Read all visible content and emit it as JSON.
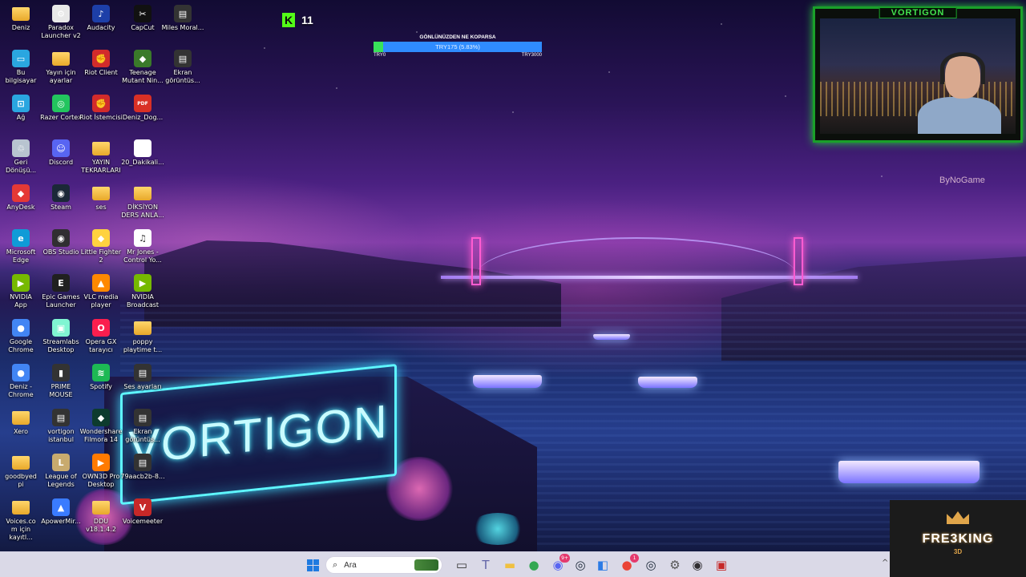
{
  "desktop_icons": [
    {
      "id": "deniz-folder",
      "label": "Deniz",
      "glyph": "folder",
      "color": "#f0c040",
      "col": 0,
      "row": 0
    },
    {
      "id": "paradox-launcher",
      "label": "Paradox Launcher v2",
      "glyph": "gear",
      "color": "#e8e8e8",
      "col": 1,
      "row": 0
    },
    {
      "id": "audacity",
      "label": "Audacity",
      "glyph": "audacity",
      "color": "#1d3fa8",
      "col": 2,
      "row": 0
    },
    {
      "id": "capcut",
      "label": "CapCut",
      "glyph": "capcut",
      "color": "#111111",
      "col": 3,
      "row": 0
    },
    {
      "id": "miles-moral",
      "label": "Miles Moral...",
      "glyph": "screenshot",
      "color": "#333333",
      "col": 4,
      "row": 0
    },
    {
      "id": "bu-bilgisayar",
      "label": "Bu bilgisayar",
      "glyph": "monitor",
      "color": "#2aa6e0",
      "col": 0,
      "row": 1
    },
    {
      "id": "yayin-icin-ayarlar",
      "label": "Yayın için ayarlar",
      "glyph": "folder",
      "color": "#f0c040",
      "col": 1,
      "row": 1
    },
    {
      "id": "riot-client",
      "label": "Riot Client",
      "glyph": "riot",
      "color": "#d22b2b",
      "col": 2,
      "row": 1
    },
    {
      "id": "teenage-mutant",
      "label": "Teenage Mutant Nin...",
      "glyph": "game",
      "color": "#3a7a2a",
      "col": 3,
      "row": 1
    },
    {
      "id": "ekran-goruntusu-1",
      "label": "Ekran görüntüs...",
      "glyph": "screenshot",
      "color": "#333333",
      "col": 4,
      "row": 1
    },
    {
      "id": "ag",
      "label": "Ağ",
      "glyph": "network",
      "color": "#2aa6e0",
      "col": 0,
      "row": 2
    },
    {
      "id": "razer-cortex",
      "label": "Razer Cortex",
      "glyph": "razer",
      "color": "#22c55e",
      "col": 1,
      "row": 2
    },
    {
      "id": "riot-istemcisi",
      "label": "Riot İstemcisi",
      "glyph": "riot",
      "color": "#d22b2b",
      "col": 2,
      "row": 2
    },
    {
      "id": "deniz-dog",
      "label": "Deniz_Dog...",
      "glyph": "pdf",
      "color": "#d93025",
      "col": 3,
      "row": 2
    },
    {
      "id": "geri-donusum",
      "label": "Geri Dönüşü...",
      "glyph": "bin",
      "color": "#b8c4d0",
      "col": 0,
      "row": 3
    },
    {
      "id": "discord",
      "label": "Discord",
      "glyph": "discord",
      "color": "#5865f2",
      "col": 1,
      "row": 3
    },
    {
      "id": "yayin-tekrarlari",
      "label": "YAYIN TEKRARLARI",
      "glyph": "folder",
      "color": "#f0c040",
      "col": 2,
      "row": 3
    },
    {
      "id": "20-dakikali",
      "label": "20_Dakikali...",
      "glyph": "file",
      "color": "#ffffff",
      "col": 3,
      "row": 3
    },
    {
      "id": "anydesk",
      "label": "AnyDesk",
      "glyph": "anydesk",
      "color": "#e53935",
      "col": 0,
      "row": 4
    },
    {
      "id": "steam",
      "label": "Steam",
      "glyph": "steam",
      "color": "#1b2838",
      "col": 1,
      "row": 4
    },
    {
      "id": "ses-folder",
      "label": "ses",
      "glyph": "folder",
      "color": "#f0c040",
      "col": 2,
      "row": 4
    },
    {
      "id": "diksiyon",
      "label": "DİKSİYON DERS ANLA...",
      "glyph": "folder",
      "color": "#f0c040",
      "col": 3,
      "row": 4
    },
    {
      "id": "microsoft-edge",
      "label": "Microsoft Edge",
      "glyph": "edge",
      "color": "#0f9bd7",
      "col": 0,
      "row": 5
    },
    {
      "id": "obs-studio",
      "label": "OBS Studio",
      "glyph": "obs",
      "color": "#302e31",
      "col": 1,
      "row": 5
    },
    {
      "id": "little-fighter",
      "label": "Little Fighter 2",
      "glyph": "game",
      "color": "#ffd23f",
      "col": 2,
      "row": 5
    },
    {
      "id": "mr-jones",
      "label": "Mr Jones - Control Yo...",
      "glyph": "mp3",
      "color": "#ffffff",
      "col": 3,
      "row": 5
    },
    {
      "id": "nvidia-app",
      "label": "NVIDIA App",
      "glyph": "nvidia",
      "color": "#76b900",
      "col": 0,
      "row": 6
    },
    {
      "id": "epic-games",
      "label": "Epic Games Launcher",
      "glyph": "epic",
      "color": "#202020",
      "col": 1,
      "row": 6
    },
    {
      "id": "vlc",
      "label": "VLC media player",
      "glyph": "vlc",
      "color": "#ff8800",
      "col": 2,
      "row": 6
    },
    {
      "id": "nvidia-broadcast",
      "label": "NVIDIA Broadcast",
      "glyph": "nvidia",
      "color": "#76b900",
      "col": 3,
      "row": 6
    },
    {
      "id": "google-chrome",
      "label": "Google Chrome",
      "glyph": "chrome",
      "color": "#4285f4",
      "col": 0,
      "row": 7
    },
    {
      "id": "streamlabs",
      "label": "Streamlabs Desktop",
      "glyph": "streamlabs",
      "color": "#80f5d2",
      "col": 1,
      "row": 7
    },
    {
      "id": "opera-gx",
      "label": "Opera GX tarayıcı",
      "glyph": "opera",
      "color": "#fa1e4e",
      "col": 2,
      "row": 7
    },
    {
      "id": "poppy-playtime",
      "label": "poppy playtime t...",
      "glyph": "folder",
      "color": "#f0c040",
      "col": 3,
      "row": 7
    },
    {
      "id": "deniz-chrome",
      "label": "Deniz - Chrome",
      "glyph": "chrome",
      "color": "#4285f4",
      "col": 0,
      "row": 8
    },
    {
      "id": "prime-mouse",
      "label": "PRIME MOUSE",
      "glyph": "mouse",
      "color": "#333333",
      "col": 1,
      "row": 8
    },
    {
      "id": "spotify",
      "label": "Spotify",
      "glyph": "spotify",
      "color": "#1db954",
      "col": 2,
      "row": 8
    },
    {
      "id": "ses-ayarlari",
      "label": "Ses ayarları",
      "glyph": "screenshot",
      "color": "#333333",
      "col": 3,
      "row": 8
    },
    {
      "id": "xero",
      "label": "Xero",
      "glyph": "folder",
      "color": "#f0c040",
      "col": 0,
      "row": 9
    },
    {
      "id": "vortigon-istanbul",
      "label": "vortigon istanbul",
      "glyph": "screenshot",
      "color": "#333333",
      "col": 1,
      "row": 9
    },
    {
      "id": "wondershare-filmora",
      "label": "Wondershare Filmora 14",
      "glyph": "filmora",
      "color": "#0d3b2e",
      "col": 2,
      "row": 9
    },
    {
      "id": "ekran-goruntusu-2",
      "label": "Ekran görüntüs...",
      "glyph": "screenshot",
      "color": "#333333",
      "col": 3,
      "row": 9
    },
    {
      "id": "goodbyedpi",
      "label": "goodbyedpi",
      "glyph": "folder",
      "color": "#f0c040",
      "col": 0,
      "row": 10
    },
    {
      "id": "league-of-legends",
      "label": "League of Legends",
      "glyph": "lol",
      "color": "#c8aa6e",
      "col": 1,
      "row": 10
    },
    {
      "id": "own3d-pro",
      "label": "OWN3D Pro Desktop",
      "glyph": "own3d",
      "color": "#ff7a00",
      "col": 2,
      "row": 10
    },
    {
      "id": "79aacb2b",
      "label": "79aacb2b-8...",
      "glyph": "screenshot",
      "color": "#333333",
      "col": 3,
      "row": 10
    },
    {
      "id": "voices-com",
      "label": "Voices.com için kayıtl...",
      "glyph": "folder",
      "color": "#f0c040",
      "col": 0,
      "row": 11
    },
    {
      "id": "apowermirror",
      "label": "ApowerMir...",
      "glyph": "apower",
      "color": "#3a7bff",
      "col": 1,
      "row": 11
    },
    {
      "id": "ddu",
      "label": "DDU v18.1.4.2",
      "glyph": "folder",
      "color": "#f0c040",
      "col": 2,
      "row": 11
    },
    {
      "id": "voicemeeter",
      "label": "Voicemeeter",
      "glyph": "voicemeeter",
      "color": "#c62828",
      "col": 3,
      "row": 11
    }
  ],
  "kick_overlay": {
    "glyph": "K",
    "viewers": "11",
    "color": "#53fc18"
  },
  "donation_goal": {
    "title": "GÖNLÜNÜZDEN NE KOPARSA",
    "progress_text": "TRY175 (5.83%)",
    "progress_fraction": 0.0583,
    "start_label": "TRY0",
    "end_label": "TRY3000",
    "bar_color": "#2f8cff",
    "fill_color": "#38e25a"
  },
  "webcam": {
    "brand": "VORTIGON",
    "frame_color": "#1aa02a"
  },
  "wallpaper": {
    "sign_text": "VORTIGON",
    "watermark": "ByNoGame"
  },
  "stream_logo": {
    "name": "FRE3KING",
    "sub": "3D"
  },
  "taskbar": {
    "search_placeholder": "Ara",
    "items": [
      {
        "id": "start",
        "icon": "windows-icon"
      },
      {
        "id": "task-view",
        "icon": "task-view-icon",
        "glyph": "▭"
      },
      {
        "id": "teams",
        "icon": "teams-icon",
        "glyph": "T",
        "color": "#6264a7"
      },
      {
        "id": "file-explorer",
        "icon": "folder-icon",
        "glyph": "▬",
        "color": "#f0c040"
      },
      {
        "id": "chrome",
        "icon": "chrome-icon",
        "glyph": "●",
        "color": "#34a853"
      },
      {
        "id": "discord",
        "icon": "discord-icon",
        "glyph": "◉",
        "color": "#5865f2",
        "badge": "9+"
      },
      {
        "id": "steam",
        "icon": "steam-icon",
        "glyph": "◎",
        "color": "#1b2838"
      },
      {
        "id": "app-3",
        "icon": "app-icon",
        "glyph": "◧",
        "color": "#2c7be5"
      },
      {
        "id": "chrome-profile",
        "icon": "chrome-icon",
        "glyph": "●",
        "color": "#ea4335",
        "badge": "1"
      },
      {
        "id": "steam-2",
        "icon": "steam-icon",
        "glyph": "◎",
        "color": "#1b2838"
      },
      {
        "id": "settings",
        "icon": "gear-icon",
        "glyph": "⚙",
        "color": "#555555"
      },
      {
        "id": "obs",
        "icon": "obs-icon",
        "glyph": "◉",
        "color": "#302e31"
      },
      {
        "id": "voicemeeter",
        "icon": "voicemeeter-icon",
        "glyph": "▣",
        "color": "#c62828"
      }
    ]
  }
}
